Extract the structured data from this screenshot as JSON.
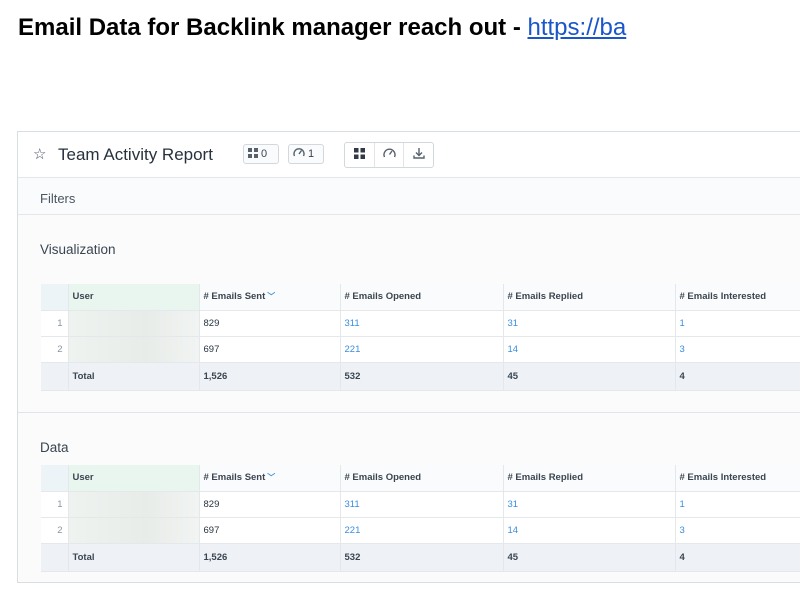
{
  "headline": {
    "text": "Email Data for Backlink manager reach out - ",
    "link": "https://ba"
  },
  "report": {
    "title": "Team Activity Report",
    "chips": [
      {
        "icon": "grid-icon",
        "count": "0"
      },
      {
        "icon": "gauge-icon",
        "count": "1"
      }
    ],
    "toolbar_icons": [
      "grid-view-icon",
      "gauge-view-icon",
      "download-icon"
    ],
    "filters_label": "Filters",
    "sections": [
      {
        "label": "Visualization"
      },
      {
        "label": "Data"
      }
    ],
    "table": {
      "columns": [
        "User",
        "# Emails Sent",
        "# Emails Opened",
        "# Emails Replied",
        "# Emails Interested"
      ],
      "sort_column": "# Emails Sent",
      "rows": [
        {
          "index": "1",
          "sent": "829",
          "opened": "311",
          "replied": "31",
          "interested": "1"
        },
        {
          "index": "2",
          "sent": "697",
          "opened": "221",
          "replied": "14",
          "interested": "3"
        }
      ],
      "total": {
        "label": "Total",
        "sent": "1,526",
        "opened": "532",
        "replied": "45",
        "interested": "4"
      }
    }
  },
  "colors": {
    "link": "#1a55c9",
    "value_link": "#3a8ee0",
    "user_header_bg": "#e9f6ef",
    "total_row_bg": "#eef2f6"
  }
}
